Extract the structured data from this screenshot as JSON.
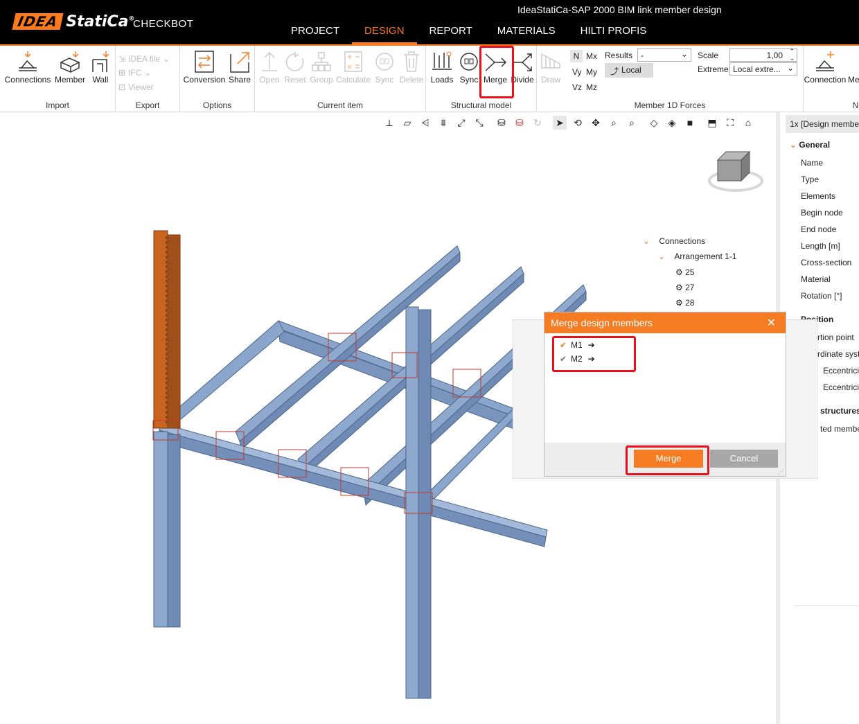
{
  "app": {
    "brand": "IDEA StatiCa",
    "brand_part1": "IDEA",
    "brand_part2": "StatiCa",
    "product": "CHECKBOT",
    "window_title": "IdeaStatiCa-SAP 2000 BIM link member design"
  },
  "main_tabs": [
    {
      "label": "PROJECT"
    },
    {
      "label": "DESIGN"
    },
    {
      "label": "REPORT"
    },
    {
      "label": "MATERIALS"
    },
    {
      "label": "HILTI PROFIS"
    }
  ],
  "ribbon": {
    "import": {
      "label": "Import",
      "buttons": [
        "Connections",
        "Member",
        "Wall"
      ]
    },
    "export": {
      "label": "Export",
      "items": [
        "IDEA file",
        "IFC",
        "Viewer"
      ]
    },
    "options": {
      "label": "Options",
      "buttons": [
        "Conversion",
        "Share"
      ]
    },
    "current_item": {
      "label": "Current item",
      "buttons": [
        "Open",
        "Reset",
        "Group",
        "Calculate",
        "Sync",
        "Delete"
      ]
    },
    "structural_model": {
      "label": "Structural model",
      "buttons": [
        "Loads",
        "Sync",
        "Merge",
        "Divide",
        "Draw"
      ]
    },
    "forces": {
      "label": "Member 1D Forces",
      "components": [
        "N",
        "Mx",
        "Vy",
        "My",
        "Vz",
        "Mz"
      ],
      "results_label": "Results",
      "results_value": "-",
      "local_label": "Local",
      "scale_label": "Scale",
      "scale_value": "1,00",
      "extreme_label": "Extreme",
      "extreme_value": "Local extre..."
    },
    "new": {
      "label": "Ne",
      "buttons": [
        "Connection",
        "Me"
      ]
    }
  },
  "tree": {
    "root": "Connections",
    "arrangement": "Arrangement 1-1",
    "items": [
      "25",
      "27",
      "28"
    ]
  },
  "right_panel": {
    "tab": "1x  [Design membe",
    "general_header": "General",
    "general_props": [
      "Name",
      "Type",
      "Elements",
      "Begin node",
      "End node",
      "Length [m]",
      "Cross-section",
      "Material",
      "Rotation [°]"
    ],
    "position_header": "Position",
    "position_props": [
      "rtion point",
      "rdinate syste",
      "Eccentricit",
      "Eccentricit"
    ],
    "structures_header": "structures",
    "structures_props": [
      "ted membe"
    ]
  },
  "dialog": {
    "title": "Merge design members",
    "members": [
      {
        "label": "M1",
        "checked": true
      },
      {
        "label": "M2",
        "checked": true
      }
    ],
    "merge_label": "Merge",
    "cancel_label": "Cancel"
  },
  "colors": {
    "accent": "#f57c22",
    "member_steel": "#7f9cc6",
    "member_selected": "#c8641e",
    "highlight": "#e8101a"
  }
}
